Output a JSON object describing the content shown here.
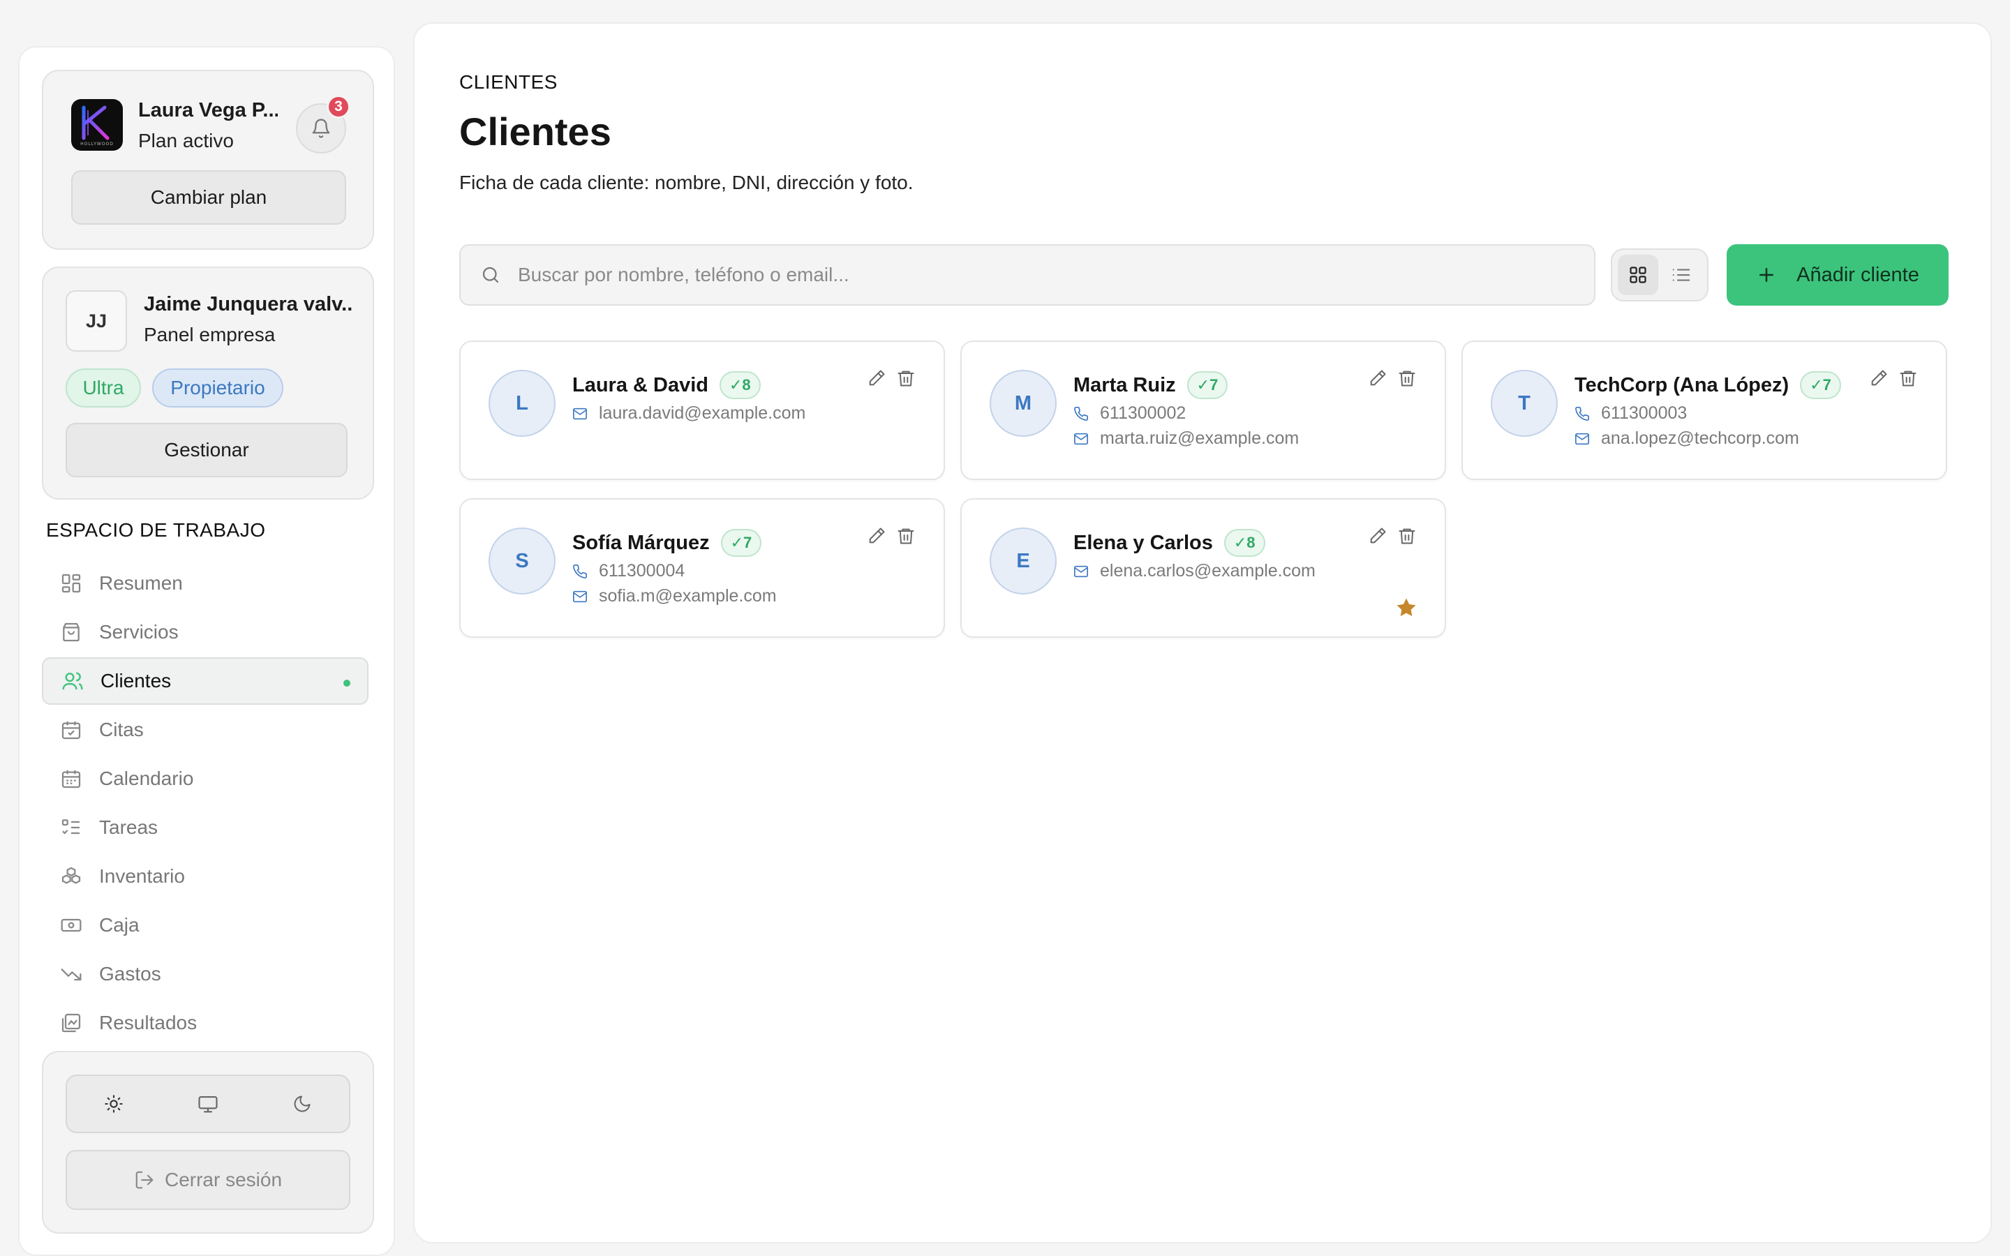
{
  "account": {
    "name": "Laura Vega P...",
    "plan": "Plan activo",
    "logo_text": "HOLLYWOOD",
    "notifications": "3",
    "change_plan_label": "Cambiar plan"
  },
  "company": {
    "initials": "JJ",
    "name": "Jaime Junquera valv...",
    "subtitle": "Panel empresa",
    "tags": [
      "Ultra",
      "Propietario"
    ],
    "manage_label": "Gestionar"
  },
  "workspace": {
    "title": "ESPACIO DE TRABAJO",
    "items": [
      {
        "label": "Resumen",
        "icon": "dashboard-icon"
      },
      {
        "label": "Servicios",
        "icon": "shopping-bag-icon"
      },
      {
        "label": "Clientes",
        "icon": "users-icon",
        "active": true
      },
      {
        "label": "Citas",
        "icon": "calendar-check-icon"
      },
      {
        "label": "Calendario",
        "icon": "calendar-icon"
      },
      {
        "label": "Tareas",
        "icon": "task-list-icon"
      },
      {
        "label": "Inventario",
        "icon": "boxes-icon"
      },
      {
        "label": "Caja",
        "icon": "cash-icon"
      },
      {
        "label": "Gastos",
        "icon": "trending-down-icon"
      },
      {
        "label": "Resultados",
        "icon": "results-icon"
      }
    ]
  },
  "footer": {
    "themes": [
      "sun-icon",
      "monitor-icon",
      "moon-icon"
    ],
    "logout_label": "Cerrar sesión"
  },
  "page": {
    "breadcrumb": "CLIENTES",
    "title": "Clientes",
    "subtitle": "Ficha de cada cliente: nombre, DNI, dirección y foto.",
    "search_placeholder": "Buscar por nombre, teléfono o email...",
    "add_label": "Añadir cliente"
  },
  "clients": [
    {
      "initial": "L",
      "name": "Laura & David",
      "badge": "✓8",
      "phone": "",
      "email": "laura.david@example.com",
      "favorite": false
    },
    {
      "initial": "M",
      "name": "Marta Ruiz",
      "badge": "✓7",
      "phone": "611300002",
      "email": "marta.ruiz@example.com",
      "favorite": false
    },
    {
      "initial": "T",
      "name": "TechCorp (Ana López)",
      "badge": "✓7",
      "phone": "611300003",
      "email": "ana.lopez@techcorp.com",
      "favorite": false
    },
    {
      "initial": "S",
      "name": "Sofía Márquez",
      "badge": "✓7",
      "phone": "611300004",
      "email": "sofia.m@example.com",
      "favorite": false
    },
    {
      "initial": "E",
      "name": "Elena y Carlos",
      "badge": "✓8",
      "phone": "",
      "email": "elena.carlos@example.com",
      "favorite": true
    }
  ],
  "colors": {
    "accent": "#3cc47c",
    "avatar_blue": "#3b78c2",
    "badge_red": "#e04a5a",
    "star": "#c6872a"
  }
}
